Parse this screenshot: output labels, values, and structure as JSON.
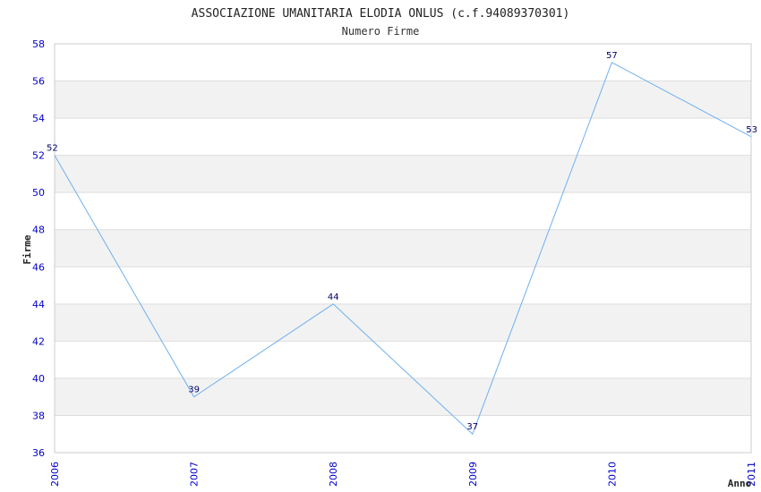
{
  "chart_data": {
    "type": "line",
    "title": "ASSOCIAZIONE UMANITARIA ELODIA ONLUS (c.f.94089370301)",
    "subtitle": "Numero Firme",
    "xlabel": "Anno",
    "ylabel": "Firme",
    "x": [
      "2006",
      "2007",
      "2008",
      "2009",
      "2010",
      "2011"
    ],
    "series": [
      {
        "values": [
          52,
          39,
          44,
          37,
          57,
          53
        ]
      }
    ],
    "data_labels": [
      "52",
      "39",
      "44",
      "37",
      "57",
      "53"
    ],
    "yticks": [
      "36",
      "38",
      "40",
      "42",
      "44",
      "46",
      "48",
      "50",
      "52",
      "54",
      "56",
      "58"
    ],
    "ylim": [
      36,
      58
    ],
    "grid": true,
    "colors": {
      "line": "#6fb0ee",
      "band": "#f2f2f2",
      "grid": "#dddddd",
      "tick_text": "#0000cc",
      "data_label": "#000066"
    }
  }
}
